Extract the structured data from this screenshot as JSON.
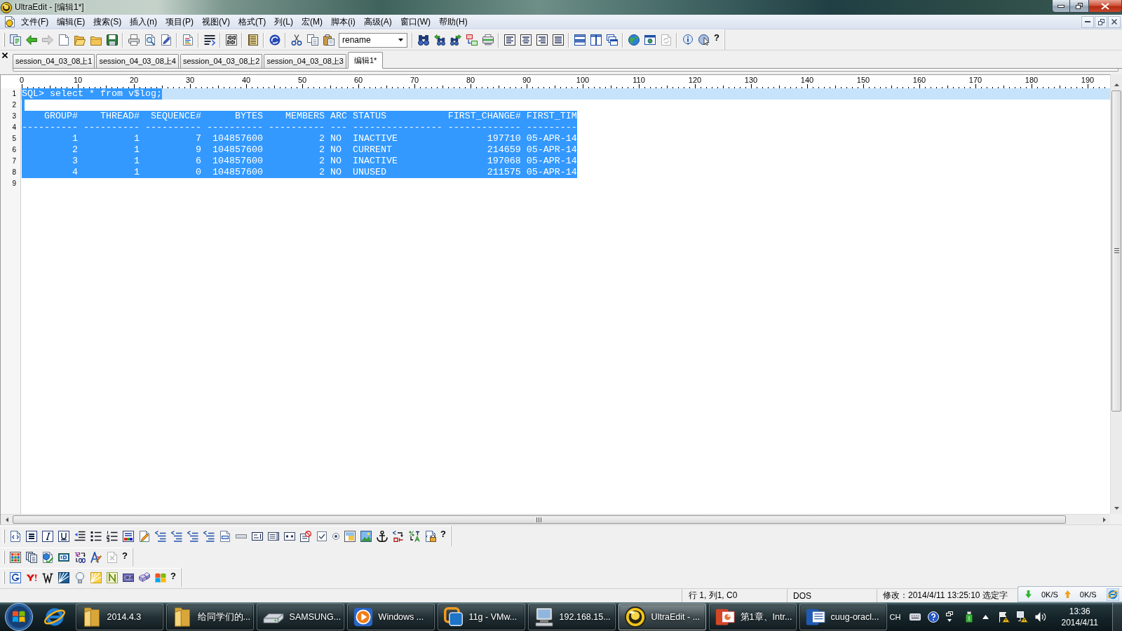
{
  "window": {
    "title": "UltraEdit - [编辑1*]"
  },
  "menu": [
    "文件(F)",
    "编辑(E)",
    "搜索(S)",
    "插入(n)",
    "项目(P)",
    "视图(V)",
    "格式(T)",
    "列(L)",
    "宏(M)",
    "脚本(i)",
    "高级(A)",
    "窗口(W)",
    "帮助(H)"
  ],
  "toolbar": {
    "search_combo": {
      "value": "rename"
    },
    "help_mark": "?"
  },
  "tabs": [
    {
      "label": "session_04_03_08上1",
      "selected": false
    },
    {
      "label": "session_04_03_08上4",
      "selected": false
    },
    {
      "label": "session_04_03_08上2",
      "selected": false
    },
    {
      "label": "session_04_03_08上3",
      "selected": false
    },
    {
      "label": "编辑1*",
      "selected": true
    }
  ],
  "ruler": [
    "0",
    "10",
    "20",
    "30",
    "40",
    "50",
    "60",
    "70",
    "80",
    "90",
    "100",
    "110",
    "120",
    "130",
    "140",
    "150",
    "160",
    "170",
    "180",
    "190"
  ],
  "editor": {
    "lines": [
      {
        "number": "1",
        "text": "SQL> select * from v$log;",
        "selected": true,
        "current": true
      },
      {
        "number": "2",
        "selected": true,
        "current": false
      },
      {
        "number": "3",
        "text": "    GROUP#    THREAD#  SEQUENCE#      BYTES    MEMBERS ARC STATUS           FIRST_CHANGE# FIRST_TIM",
        "selected": true,
        "current": false
      },
      {
        "number": "4",
        "text": "---------- ---------- ---------- ---------- ---------- --- ---------------- ------------- ---------",
        "selected": true,
        "current": false
      },
      {
        "number": "5",
        "text": "         1          1          7  104857600          2 NO  INACTIVE                197710 05-APR-14",
        "selected": true,
        "current": false
      },
      {
        "number": "6",
        "text": "         2          1          9  104857600          2 NO  CURRENT                 214659 05-APR-14",
        "selected": true,
        "current": false
      },
      {
        "number": "7",
        "text": "         3          1          6  104857600          2 NO  INACTIVE                197068 05-APR-14",
        "selected": true,
        "current": false
      },
      {
        "number": "8",
        "text": "         4          1          0  104857600          2 NO  UNUSED                  211575 05-APR-14",
        "selected": true,
        "current": false
      },
      {
        "number": "9",
        "selected": false,
        "current": false
      }
    ]
  },
  "bottom_toolbars": [
    {
      "help_mark": "?"
    },
    {
      "help_mark": "?"
    },
    {
      "help_mark": "?"
    }
  ],
  "status_bar": {
    "position": "行 1, 列1, C0",
    "line_ending": "DOS",
    "modified": "修改：2014/4/11 13:25:10 选定字"
  },
  "network_monitor": {
    "download": "0K/S",
    "upload": "0K/S"
  },
  "taskbar": {
    "buttons": [
      {
        "label": "2014.4.3",
        "selected": false
      },
      {
        "label": "给同学们的...",
        "selected": false
      },
      {
        "label": "SAMSUNG...",
        "selected": false
      },
      {
        "label": "Windows ...",
        "selected": false
      },
      {
        "label": "11g - VMw...",
        "selected": false
      },
      {
        "label": "192.168.15...",
        "selected": false
      },
      {
        "label": "UltraEdit - ...",
        "selected": true
      },
      {
        "label": "第1章、Intr...",
        "selected": false
      },
      {
        "label": "cuug-oracl...",
        "selected": false
      }
    ],
    "tray": {
      "language": "CH",
      "time": "13:36",
      "date": "2014/4/11"
    }
  }
}
